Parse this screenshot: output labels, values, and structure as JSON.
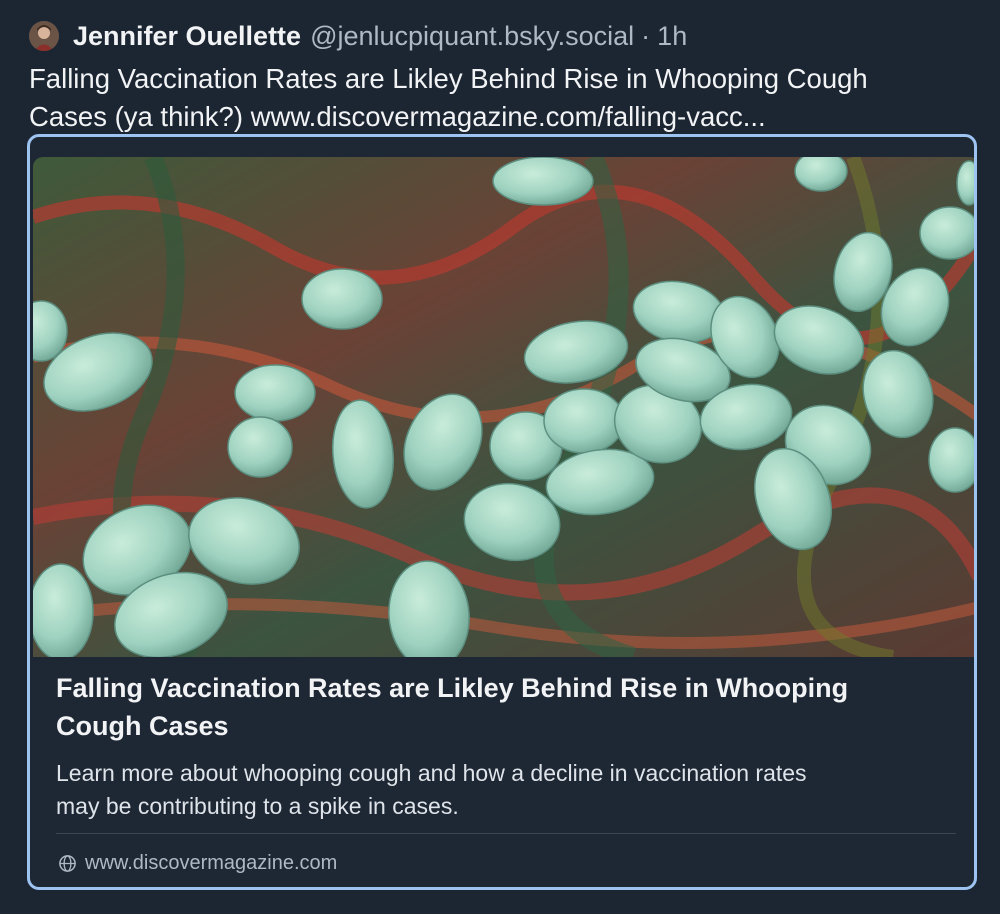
{
  "post": {
    "author_name": "Jennifer Ouellette",
    "author_handle": "@jenlucpiquant.bsky.social",
    "separator": "·",
    "time": "1h",
    "text_lines": [
      "Falling Vaccination Rates are Likley Behind Rise in Whooping Cough",
      "Cases (ya think?) www.discovermagazine.com/falling-vacc..."
    ]
  },
  "card": {
    "title_lines": [
      "Falling Vaccination Rates are Likley Behind Rise in Whooping",
      "Cough Cases"
    ],
    "description_lines": [
      "Learn more about whooping cough and how a decline in vaccination rates",
      "may be contributing to a spike in cases."
    ],
    "domain": "www.discovermagazine.com",
    "domain_icon": "globe-icon"
  },
  "colors": {
    "background": "#1c2532",
    "card_border": "#9dc3f1",
    "handle_text": "#aeb9c6"
  }
}
